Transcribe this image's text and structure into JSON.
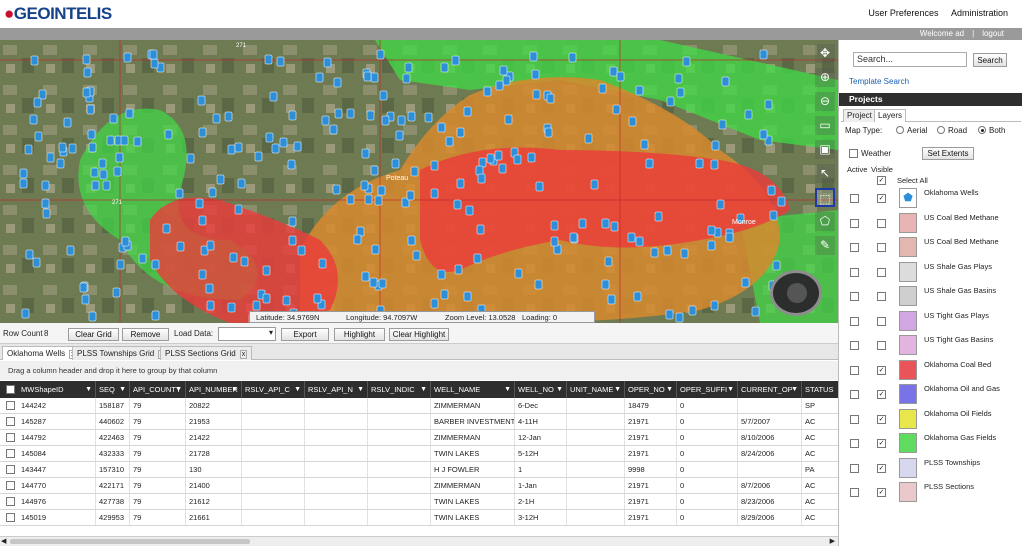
{
  "header": {
    "logo_text": "GEOINTELIS",
    "nav": [
      "User Preferences",
      "Administration"
    ]
  },
  "user_bar": {
    "welcome": "Welcome ad",
    "separator": "|",
    "logout": "logout"
  },
  "map": {
    "latitude": "Latitude: 34.9769N",
    "longitude": "Longitude: 94.7097W",
    "zoom": "Zoom Level: 13.0528",
    "loading": "Loading: 0",
    "place_labels": [
      "Poteau",
      "Monroe",
      "271",
      "271"
    ],
    "tools": [
      {
        "icon": "pan-icon",
        "glyph": "✥"
      },
      {
        "icon": "zoom-in-icon",
        "glyph": "⊕"
      },
      {
        "icon": "zoom-out-icon",
        "glyph": "⊖"
      },
      {
        "icon": "print-icon",
        "glyph": "▭"
      },
      {
        "icon": "screenshot-icon",
        "glyph": "▣"
      },
      {
        "icon": "identify-icon",
        "glyph": "↖"
      },
      {
        "icon": "select-icon",
        "glyph": "⬚"
      },
      {
        "icon": "polygon-icon",
        "glyph": "⬠"
      },
      {
        "icon": "pencil-icon",
        "glyph": "✎"
      }
    ],
    "colors": {
      "satellite": "#6f7a54",
      "orange": "#d88a2e",
      "red": "#ec3b3b",
      "green": "#3fdc46",
      "marker": "#2d8fd8",
      "grid": "#c02a2a"
    }
  },
  "toolbar": {
    "row_count_label": "Row Count",
    "row_count": "8",
    "clear_grid": "Clear Grid",
    "remove": "Remove",
    "load_data": "Load Data:",
    "export": "Export",
    "highlight": "Highlight",
    "clear_highlight": "Clear Highlight"
  },
  "tabs": [
    "Oklahoma Wells",
    "PLSS Townships Grid",
    "PLSS Sections Grid"
  ],
  "group_hint": "Drag a column header and drop it here to group by that column",
  "grid": {
    "columns": [
      "MWShapeID",
      "SEQ",
      "API_COUNTY",
      "API_NUMBER",
      "RSLV_API_C",
      "RSLV_API_N",
      "RSLV_INDIC",
      "WELL_NAME",
      "WELL_NO",
      "UNIT_NAME",
      "OPER_NO",
      "OPER_SUFFI",
      "CURRENT_OP",
      "STATUS"
    ],
    "rows": [
      [
        "144242",
        "158187",
        "79",
        "20822",
        "",
        "",
        "",
        "ZIMMERMAN",
        "6-Dec",
        "",
        "18479",
        "0",
        "",
        "SP"
      ],
      [
        "145287",
        "440602",
        "79",
        "21953",
        "",
        "",
        "",
        "BARBER INVESTMENTS",
        "4-11H",
        "",
        "21971",
        "0",
        "5/7/2007",
        "AC"
      ],
      [
        "144792",
        "422463",
        "79",
        "21422",
        "",
        "",
        "",
        "ZIMMERMAN",
        "12-Jan",
        "",
        "21971",
        "0",
        "8/10/2006",
        "AC"
      ],
      [
        "145084",
        "432333",
        "79",
        "21728",
        "",
        "",
        "",
        "TWIN LAKES",
        "5-12H",
        "",
        "21971",
        "0",
        "8/24/2006",
        "AC"
      ],
      [
        "143447",
        "157310",
        "79",
        "130",
        "",
        "",
        "",
        "H J FOWLER",
        "1",
        "",
        "9998",
        "0",
        "",
        "PA"
      ],
      [
        "144770",
        "422171",
        "79",
        "21400",
        "",
        "",
        "",
        "ZIMMERMAN",
        "1-Jan",
        "",
        "21971",
        "0",
        "8/7/2006",
        "AC"
      ],
      [
        "144976",
        "427738",
        "79",
        "21612",
        "",
        "",
        "",
        "TWIN LAKES",
        "2-1H",
        "",
        "21971",
        "0",
        "8/23/2006",
        "AC"
      ],
      [
        "145019",
        "429953",
        "79",
        "21661",
        "",
        "",
        "",
        "TWIN LAKES",
        "3-12H",
        "",
        "21971",
        "0",
        "8/29/2006",
        "AC"
      ]
    ]
  },
  "sidebar": {
    "search_value": "Search...",
    "search_button": "Search",
    "template_search": "Template Search",
    "projects_title": "Projects",
    "ptabs": [
      "Project",
      "Layers"
    ],
    "map_type_label": "Map Type:",
    "map_types": [
      "Aerial",
      "Road",
      "Both"
    ],
    "map_type_selected": "Both",
    "weather": "Weather",
    "set_extents": "Set Extents",
    "active": "Active",
    "visible": "Visible",
    "select_all": "Select All",
    "layers": [
      {
        "name": "Oklahoma Wells",
        "color": "#ffffff",
        "visible": true,
        "icon": "well-marker-icon"
      },
      {
        "name": "US Coal Bed Methane",
        "color": "#e8b4b4",
        "visible": false
      },
      {
        "name": "US Coal Bed Methane",
        "color": "#e3b7b0",
        "visible": false
      },
      {
        "name": "US Shale Gas Plays",
        "color": "#dcdcdc",
        "visible": false
      },
      {
        "name": "US Shale Gas Basins",
        "color": "#cfcfcf",
        "visible": false
      },
      {
        "name": "US Tight Gas Plays",
        "color": "#d2a6e3",
        "visible": false
      },
      {
        "name": "US Tight Gas Basins",
        "color": "#e2b5e0",
        "visible": false
      },
      {
        "name": "Oklahoma Coal Bed",
        "color": "#e8545a",
        "visible": true
      },
      {
        "name": "Oklahoma Oil and Gas",
        "color": "#7a73e8",
        "visible": true
      },
      {
        "name": "Oklahoma Oil Fields",
        "color": "#e7e64a",
        "visible": true
      },
      {
        "name": "Oklahoma Gas Fields",
        "color": "#5fdc5f",
        "visible": true
      },
      {
        "name": "PLSS Townships",
        "color": "#d7d7ee",
        "visible": true
      },
      {
        "name": "PLSS Sections",
        "color": "#e9c9c9",
        "visible": true
      }
    ]
  }
}
